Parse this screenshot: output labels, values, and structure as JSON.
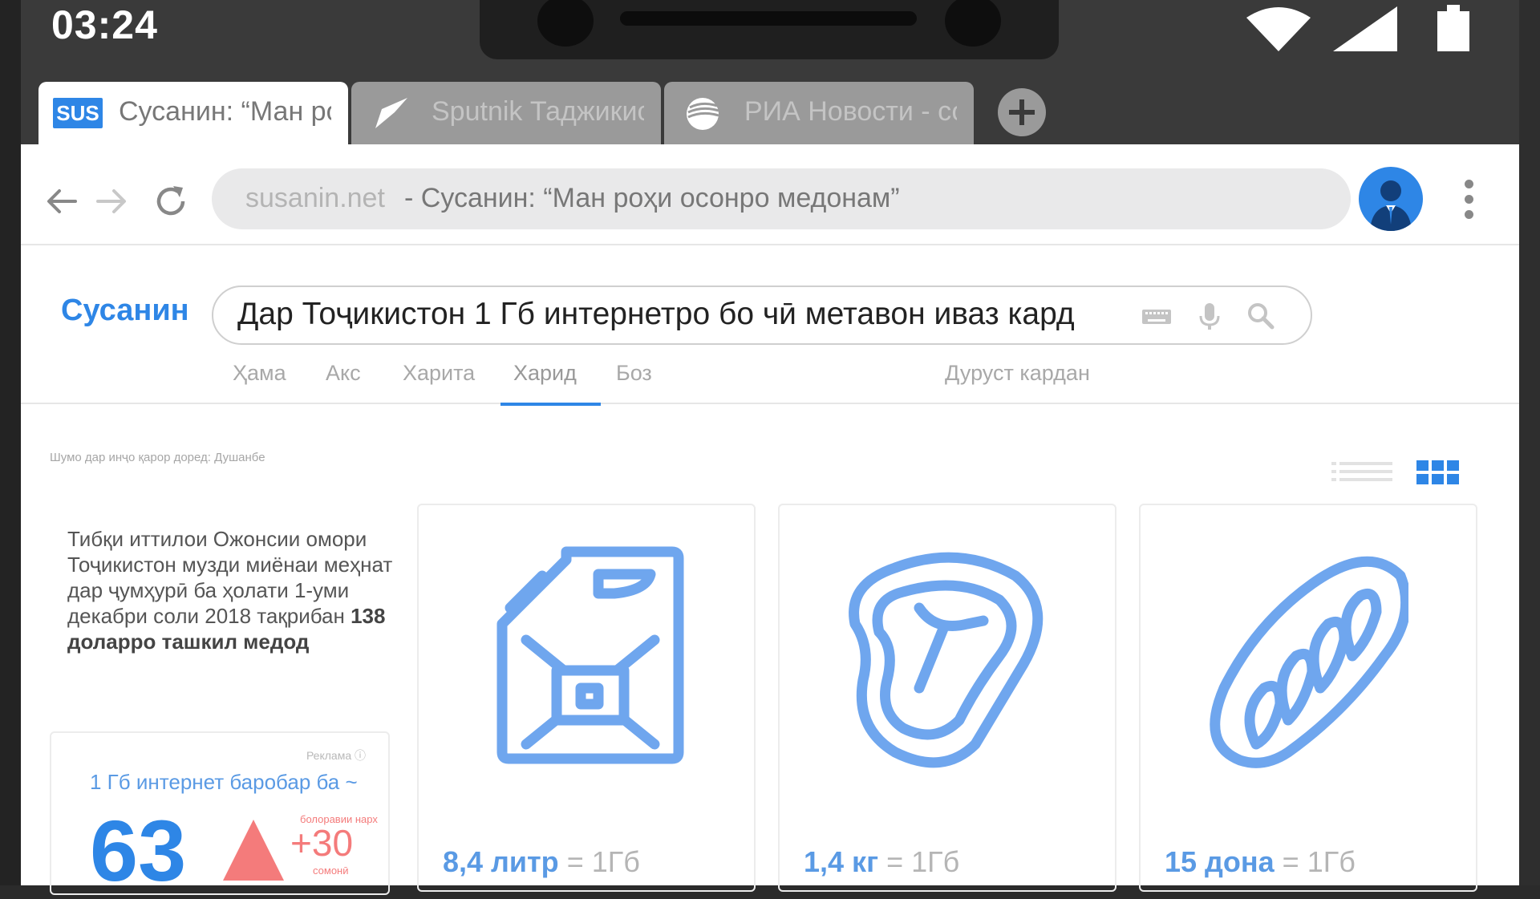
{
  "status_bar": {
    "time": "03:24"
  },
  "tabs": [
    {
      "title": "Сусанин: “Ман рохи осонро медонам”",
      "favicon": "SUS"
    },
    {
      "title": "Sputnik Таджикистан"
    },
    {
      "title": "РИА Новости - события"
    }
  ],
  "omnibox": {
    "host": "susanin.net",
    "title": "- Сусанин: “Ман роҳи осонро медонам”"
  },
  "logo": "Сусанин",
  "search": {
    "query": "Дар Тоҷикистон 1 Гб интернетро бо чӣ метавон иваз кард"
  },
  "nav_tabs": [
    "Ҳама",
    "Акс",
    "Харита",
    "Харид",
    "Боз"
  ],
  "nav_active": "Харид",
  "settings_link": "Дуруст кардан",
  "location_text": "Шумо дар инҷо қарор доред: Душанбе",
  "info": {
    "pre": "Тибқи иттилои Ожонсии омори Тоҷикистон музди миёнаи меҳнат дар ҷумҳурӣ ба ҳолати 1-уми декабри соли 2018 тақрибан ",
    "bold": "138 доларро ташкил медод"
  },
  "ad": {
    "label": "Реклама ⓘ",
    "headline": "1 Гб интернет баробар ба ~",
    "value": "63",
    "change": "+30",
    "change_label": "болоравии нарх",
    "currency": "сомонӣ"
  },
  "products": [
    {
      "amount": "8,4 литр",
      "eq": "= 1Гб",
      "icon": "jerrycan-icon"
    },
    {
      "amount": "1,4 кг",
      "eq": "= 1Гб",
      "icon": "steak-icon"
    },
    {
      "amount": "15 дона",
      "eq": "= 1Гб",
      "icon": "bread-icon"
    }
  ],
  "colors": {
    "accent": "#2e86e6",
    "icon_blue": "#6fa6ee",
    "ad_red": "#f47b7b"
  }
}
